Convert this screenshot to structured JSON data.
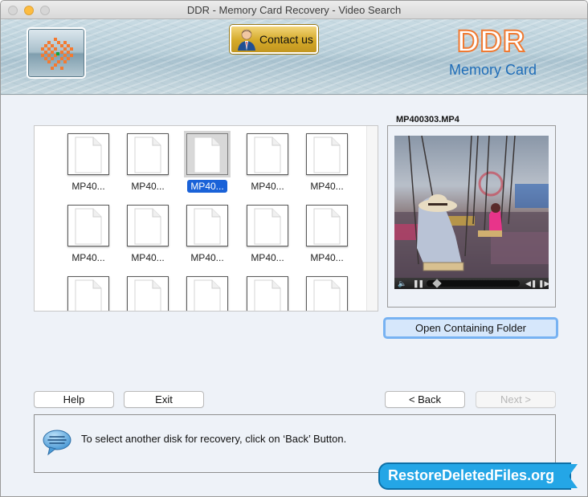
{
  "window": {
    "title": "DDR - Memory Card Recovery - Video Search"
  },
  "header": {
    "contact_button": "Contact us",
    "brand_name": "DDR",
    "brand_subtitle": "Memory Card"
  },
  "file_grid": {
    "selected_index": 2,
    "items": [
      {
        "label": "MP40..."
      },
      {
        "label": "MP40..."
      },
      {
        "label": "MP40..."
      },
      {
        "label": "MP40..."
      },
      {
        "label": "MP40..."
      },
      {
        "label": "MP40..."
      },
      {
        "label": "MP40..."
      },
      {
        "label": "MP40..."
      },
      {
        "label": "MP40..."
      },
      {
        "label": "MP40..."
      },
      {
        "label": ""
      },
      {
        "label": ""
      },
      {
        "label": ""
      },
      {
        "label": ""
      },
      {
        "label": ""
      }
    ]
  },
  "preview": {
    "file_name": "MP400303.MP4",
    "playback_progress": 0.06,
    "open_folder_button": "Open Containing Folder"
  },
  "buttons": {
    "help": "Help",
    "exit": "Exit",
    "back": "< Back",
    "next": "Next >"
  },
  "message": {
    "text": "To select another disk for recovery, click on ‘Back’ Button."
  },
  "watermark": {
    "text": "RestoreDeletedFiles.org"
  },
  "colors": {
    "selection": "#1a62d8",
    "brand_orange": "#f07a32",
    "brand_blue": "#1f6db8",
    "focus_ring": "#77b2f2"
  }
}
